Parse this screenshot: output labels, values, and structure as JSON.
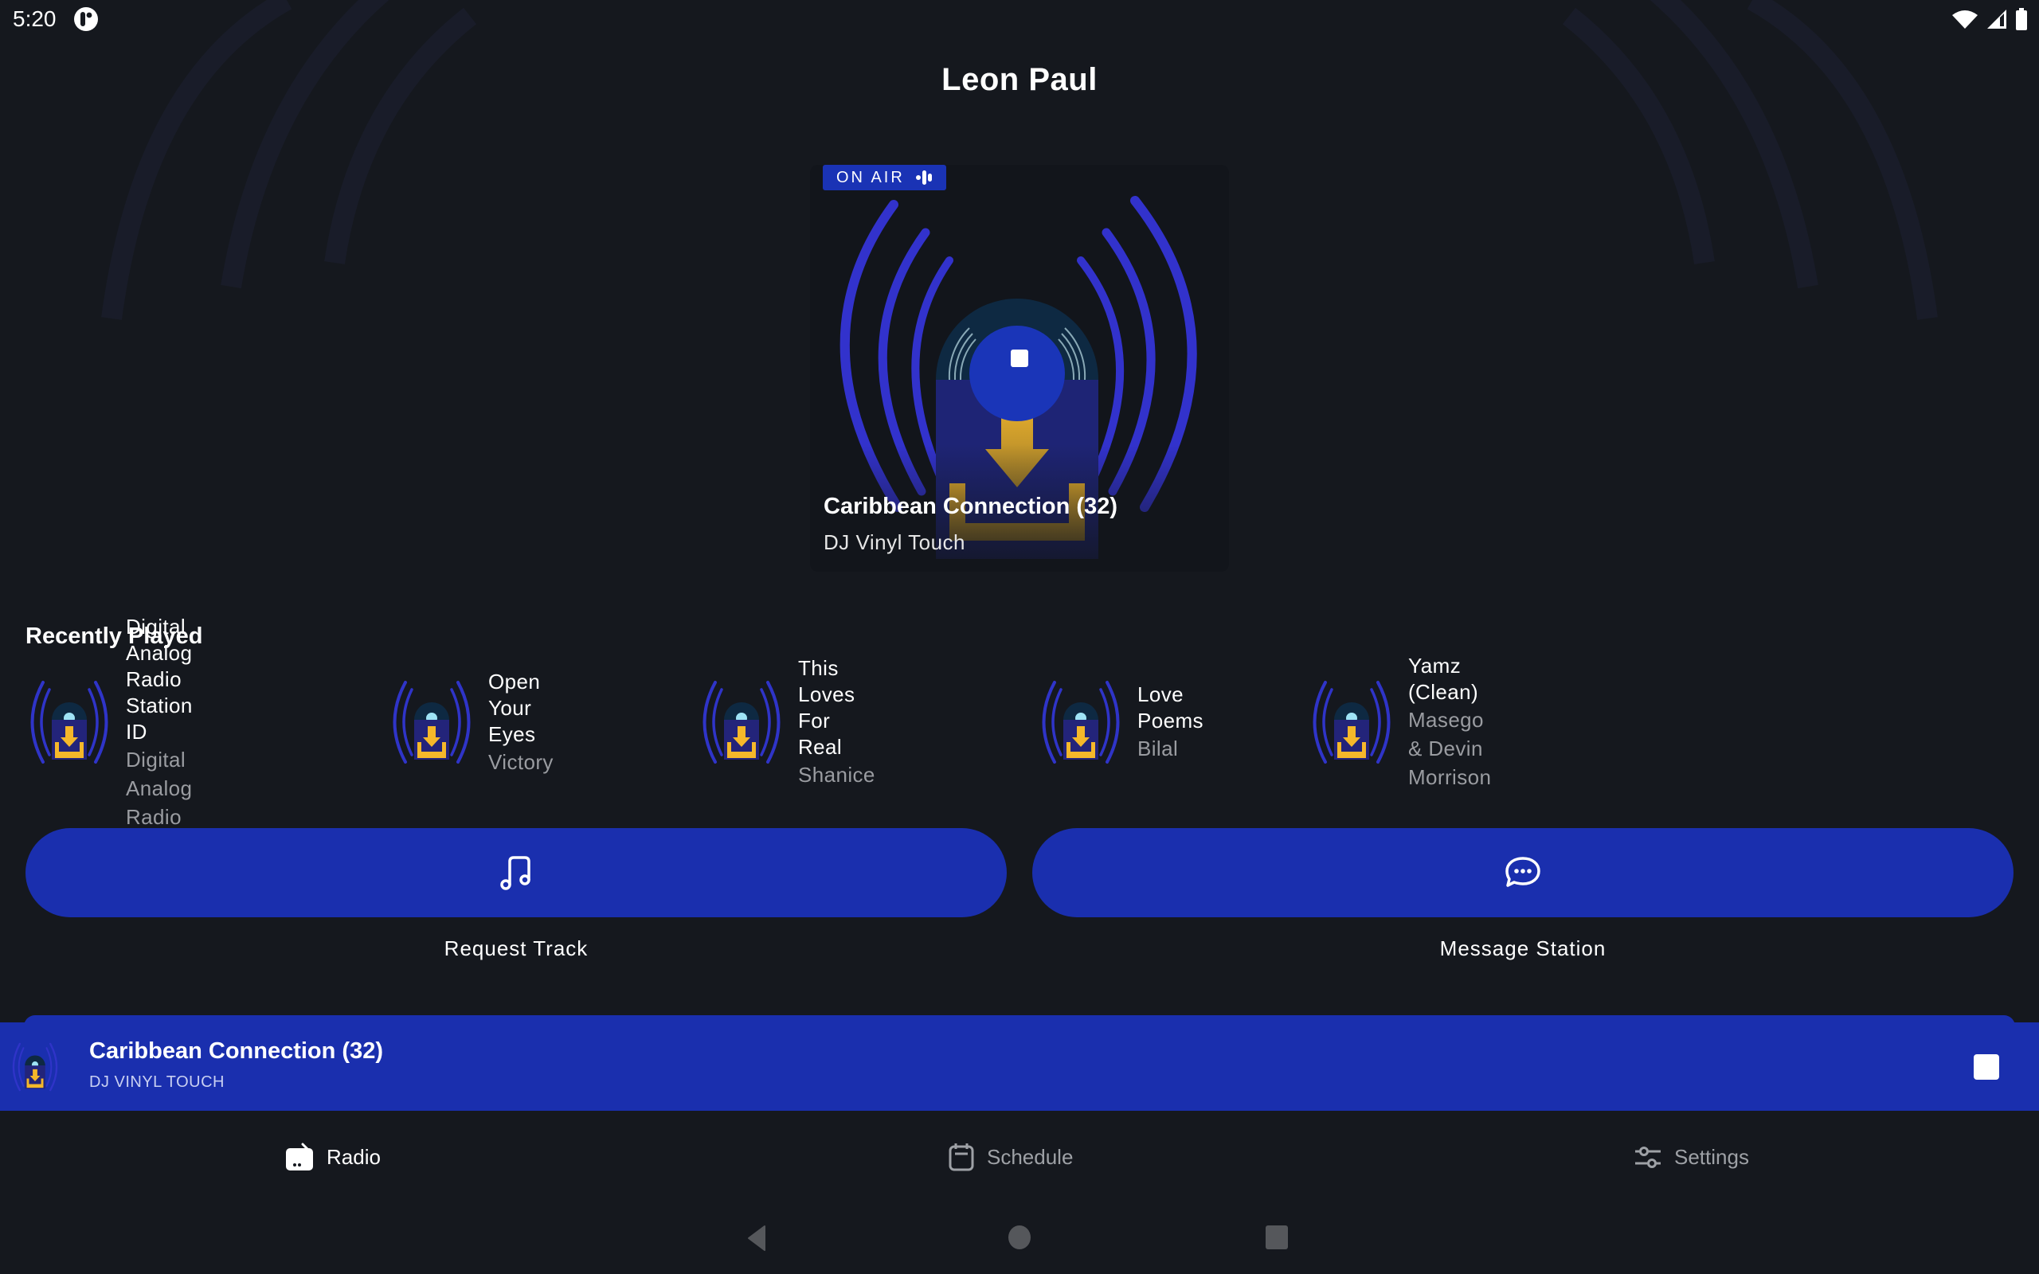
{
  "status_bar": {
    "time": "5:20",
    "notification_icon": "app-notification-icon",
    "right_icons": [
      "wifi-icon",
      "cell-signal-icon",
      "battery-icon"
    ]
  },
  "header": {
    "title": "Leon Paul"
  },
  "now_playing": {
    "badge": "ON AIR",
    "badge_icon": "audio-wave-icon",
    "title": "Caribbean Connection (32)",
    "artist": "DJ Vinyl Touch",
    "control_icon": "stop-icon"
  },
  "recently_played": {
    "heading": "Recently Played",
    "items": [
      {
        "title_line1": "Digital Analog Radio",
        "title_line2": "Station ID",
        "artist": "Digital Analog Radio"
      },
      {
        "title_line1": "Open Your Eyes",
        "title_line2": "",
        "artist": "Victory"
      },
      {
        "title_line1": "This Loves For Real",
        "title_line2": "",
        "artist": "Shanice"
      },
      {
        "title_line1": "Love Poems",
        "title_line2": "",
        "artist": "Bilal"
      },
      {
        "title_line1": "Yamz (Clean)",
        "title_line2": "",
        "artist": "Masego & Devin Morrison"
      }
    ]
  },
  "actions": {
    "request": {
      "label": "Request Track",
      "icon": "music-note-icon"
    },
    "message": {
      "label": "Message Station",
      "icon": "chat-bubble-icon"
    }
  },
  "mini_player": {
    "title": "Caribbean Connection (32)",
    "artist": "DJ VINYL TOUCH",
    "control_icon": "stop-icon"
  },
  "bottom_nav": {
    "items": [
      {
        "label": "Radio",
        "icon": "radio-icon",
        "active": true
      },
      {
        "label": "Schedule",
        "icon": "calendar-icon",
        "active": false
      },
      {
        "label": "Settings",
        "icon": "sliders-icon",
        "active": false
      }
    ]
  },
  "system_nav": [
    "back-button",
    "home-button",
    "recents-button"
  ],
  "colors": {
    "background": "#15181e",
    "accent": "#1a2fae",
    "badge": "#1a33b5",
    "art_gold": "#f0b82b",
    "muted_text": "#9a9ca1"
  }
}
